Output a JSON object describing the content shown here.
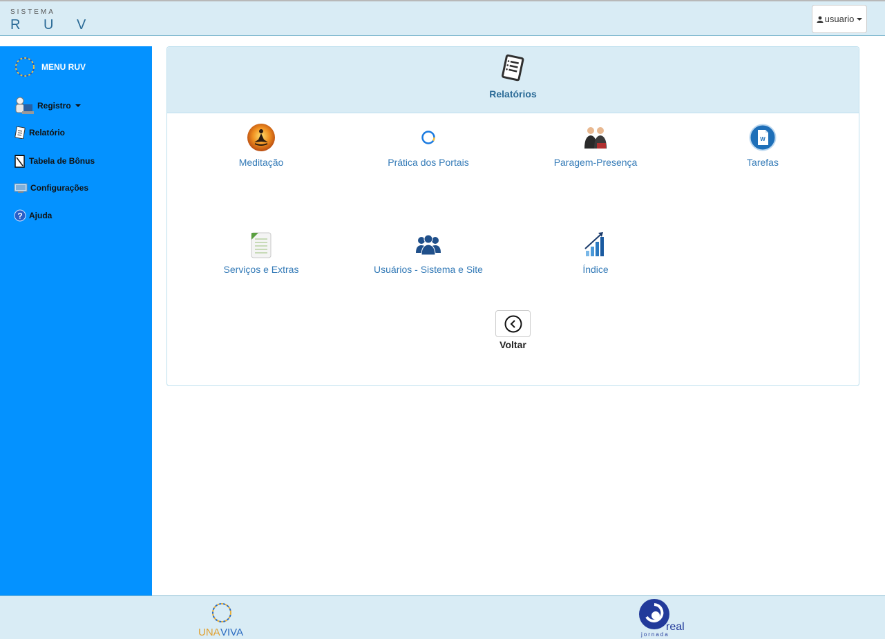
{
  "header": {
    "system_label": "SISTEMA",
    "app_name": "R U V",
    "user_label": "usuario"
  },
  "sidebar": {
    "menu_title": "MENU RUV",
    "items": [
      {
        "label": "Registro",
        "icon": "user-computer-icon",
        "has_dropdown": true
      },
      {
        "label": "Relatório",
        "icon": "report-icon"
      },
      {
        "label": "Tabela de Bônus",
        "icon": "notepad-icon"
      },
      {
        "label": "Configurações",
        "icon": "monitor-settings-icon"
      },
      {
        "label": "Ajuda",
        "icon": "help-icon"
      }
    ]
  },
  "panel": {
    "title": "Relatórios",
    "icon": "report-document-icon",
    "tiles": [
      {
        "label": "Meditação",
        "icon": "meditation-icon"
      },
      {
        "label": "Prática dos Portais",
        "icon": "portal-circle-icon"
      },
      {
        "label": "Paragem-Presença",
        "icon": "people-meeting-icon"
      },
      {
        "label": "Tarefas",
        "icon": "task-document-icon"
      },
      {
        "label": "Serviços e Extras",
        "icon": "notes-icon"
      },
      {
        "label": "Usuários - Sistema e Site",
        "icon": "users-group-icon"
      },
      {
        "label": "Índice",
        "icon": "growth-chart-icon"
      }
    ],
    "back_label": "Voltar"
  },
  "footer": {
    "logo_left": {
      "part1": "UNA",
      "part2": "VIVA"
    },
    "logo_right": {
      "main": "real",
      "sub": "jornada"
    }
  },
  "colors": {
    "sidebar": "#0492ff",
    "header_bg": "#d9ecf5",
    "link": "#337ab7",
    "title": "#2a6a96"
  }
}
